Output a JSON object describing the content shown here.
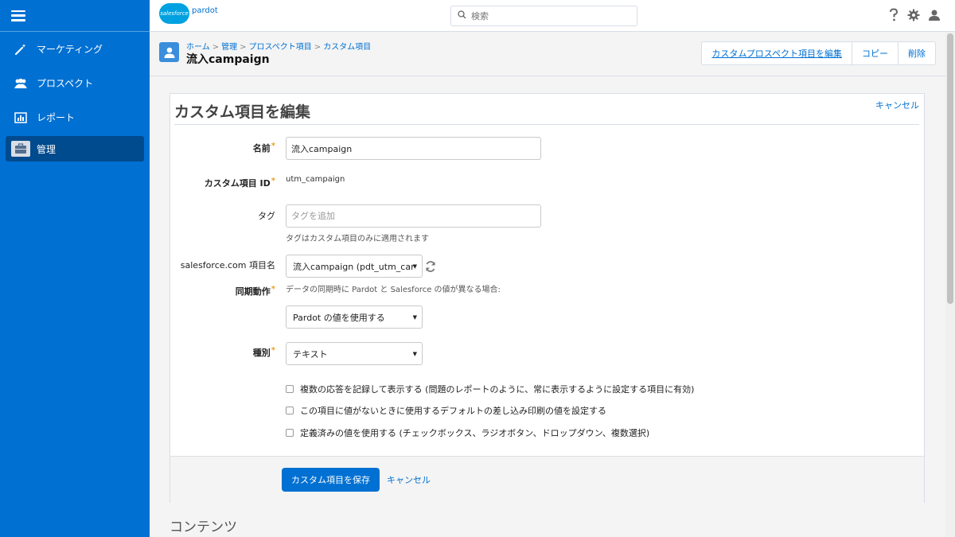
{
  "sidebar": {
    "items": [
      {
        "label": "マーケティング",
        "icon": "wand-icon"
      },
      {
        "label": "プロスペクト",
        "icon": "people-icon"
      },
      {
        "label": "レポート",
        "icon": "chart-icon"
      },
      {
        "label": "管理",
        "icon": "briefcase-icon"
      }
    ]
  },
  "header": {
    "logo_cloud": "salesforce",
    "logo_product": "pardot",
    "search_placeholder": "検索"
  },
  "pagehead": {
    "breadcrumbs": [
      "ホーム",
      "管理",
      "プロスペクト項目",
      "カスタム項目"
    ],
    "title": "流入campaign",
    "actions": [
      "カスタムプロスペクト項目を編集",
      "コピー",
      "削除"
    ]
  },
  "form": {
    "title": "カスタム項目を編集",
    "cancel_top": "キャンセル",
    "name_label": "名前",
    "name_value": "流入campaign",
    "id_label": "カスタム項目 ID",
    "id_value": "utm_campaign",
    "tag_label": "タグ",
    "tag_placeholder": "タグを追加",
    "tag_help": "タグはカスタム項目のみに適用されます",
    "sf_label": "salesforce.com 項目名",
    "sf_value": "流入campaign (pdt_utm_car",
    "sync_label": "同期動作",
    "sync_help": "データの同期時に Pardot と Salesforce の値が異なる場合:",
    "sync_value": "Pardot の値を使用する",
    "type_label": "種別",
    "type_value": "テキスト",
    "checkboxes": [
      "複数の応答を記録して表示する (問題のレポートのように、常に表示するように設定する項目に有効)",
      "この項目に値がないときに使用するデフォルトの差し込み印刷の値を設定する",
      "定義済みの値を使用する (チェックボックス、ラジオボタン、ドロップダウン、複数選択)"
    ],
    "save_label": "カスタム項目を保存",
    "cancel_label": "キャンセル"
  },
  "section2_title": "コンテンツ",
  "colors": {
    "sidebar": "#0070d2",
    "sidebar_active": "#004a8e",
    "link": "#0070d2",
    "required": "#e8a317"
  }
}
